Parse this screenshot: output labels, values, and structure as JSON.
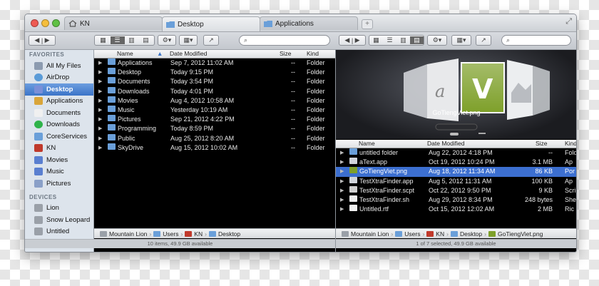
{
  "tabs": [
    {
      "label": "KN",
      "icon": "home-icon"
    },
    {
      "label": "Desktop",
      "icon": "folder-icon"
    },
    {
      "label": "Applications",
      "icon": "folder-icon"
    }
  ],
  "sidebar": {
    "favorites_header": "FAVORITES",
    "favorites": [
      {
        "label": "All My Files",
        "icon": "all-files-icon"
      },
      {
        "label": "AirDrop",
        "icon": "airdrop-icon"
      },
      {
        "label": "Desktop",
        "icon": "desktop-icon",
        "selected": true
      },
      {
        "label": "Applications",
        "icon": "applications-icon"
      },
      {
        "label": "Documents",
        "icon": "documents-icon"
      },
      {
        "label": "Downloads",
        "icon": "downloads-icon"
      },
      {
        "label": "CoreServices",
        "icon": "folder-icon"
      },
      {
        "label": "KN",
        "icon": "home-icon"
      },
      {
        "label": "Movies",
        "icon": "movies-icon"
      },
      {
        "label": "Music",
        "icon": "music-icon"
      },
      {
        "label": "Pictures",
        "icon": "pictures-icon"
      }
    ],
    "devices_header": "DEVICES",
    "devices": [
      {
        "label": "Lion",
        "icon": "disk-icon"
      },
      {
        "label": "Snow Leopard",
        "icon": "disk-icon"
      },
      {
        "label": "Untitled",
        "icon": "disk-icon"
      }
    ]
  },
  "left_pane": {
    "columns": {
      "name": "Name",
      "date": "Date Modified",
      "size": "Size",
      "kind": "Kind"
    },
    "rows": [
      {
        "name": "Applications",
        "date": "Sep 7, 2012 11:02 AM",
        "size": "--",
        "kind": "Folder"
      },
      {
        "name": "Desktop",
        "date": "Today 9:15 PM",
        "size": "--",
        "kind": "Folder"
      },
      {
        "name": "Documents",
        "date": "Today 3:54 PM",
        "size": "--",
        "kind": "Folder"
      },
      {
        "name": "Downloads",
        "date": "Today 4:01 PM",
        "size": "--",
        "kind": "Folder"
      },
      {
        "name": "Movies",
        "date": "Aug 4, 2012 10:58 AM",
        "size": "--",
        "kind": "Folder"
      },
      {
        "name": "Music",
        "date": "Yesterday 10:19 AM",
        "size": "--",
        "kind": "Folder"
      },
      {
        "name": "Pictures",
        "date": "Sep 21, 2012 4:22 PM",
        "size": "--",
        "kind": "Folder"
      },
      {
        "name": "Programming",
        "date": "Today 8:59 PM",
        "size": "--",
        "kind": "Folder"
      },
      {
        "name": "Public",
        "date": "Aug 25, 2012 8:20 AM",
        "size": "--",
        "kind": "Folder"
      },
      {
        "name": "SkyDrive",
        "date": "Aug 15, 2012 10:02 AM",
        "size": "--",
        "kind": "Folder"
      }
    ],
    "path": [
      "Mountain Lion",
      "Users",
      "KN",
      "Desktop"
    ],
    "status": "10 items, 49.9 GB available"
  },
  "right_pane": {
    "preview": {
      "caption": "GoTiengViet.png",
      "letter": "V",
      "doc_letter": "a"
    },
    "columns": {
      "name": "Name",
      "date": "Date Modified",
      "size": "Size",
      "kind": "Kind"
    },
    "rows": [
      {
        "name": "untitled folder",
        "date": "Aug 22, 2012 4:18 PM",
        "size": "--",
        "kind": "Fold",
        "icon": "folder-icon",
        "expandable": true
      },
      {
        "name": "aText.app",
        "date": "Oct 19, 2012 10:24 PM",
        "size": "3.1 MB",
        "kind": "Ap",
        "icon": "app-icon"
      },
      {
        "name": "GoTiengViet.png",
        "date": "Aug 18, 2012 11:34 AM",
        "size": "86 KB",
        "kind": "Por",
        "icon": "image-icon",
        "selected": true
      },
      {
        "name": "TestXtraFinder.app",
        "date": "Aug 5, 2012 11:31 AM",
        "size": "100 KB",
        "kind": "Ap",
        "icon": "app-icon"
      },
      {
        "name": "TestXtraFinder.scpt",
        "date": "Oct 22, 2012 9:50 PM",
        "size": "9 KB",
        "kind": "Scri",
        "icon": "script-icon"
      },
      {
        "name": "TestXtraFinder.sh",
        "date": "Aug 29, 2012 8:34 PM",
        "size": "248 bytes",
        "kind": "She",
        "icon": "shell-icon"
      },
      {
        "name": "Untitled.rtf",
        "date": "Oct 15, 2012 12:02 AM",
        "size": "2 MB",
        "kind": "Ric",
        "icon": "document-icon"
      }
    ],
    "path": [
      "Mountain Lion",
      "Users",
      "KN",
      "Desktop",
      "GoTiengViet.png"
    ],
    "status": "1 of 7 selected, 49.9 GB available"
  },
  "colors": {
    "selection": "#3c6fd0",
    "sidebar_selection": "#3b74c8",
    "pane_bg": "#000000",
    "accent_green": "#6b8e23"
  }
}
